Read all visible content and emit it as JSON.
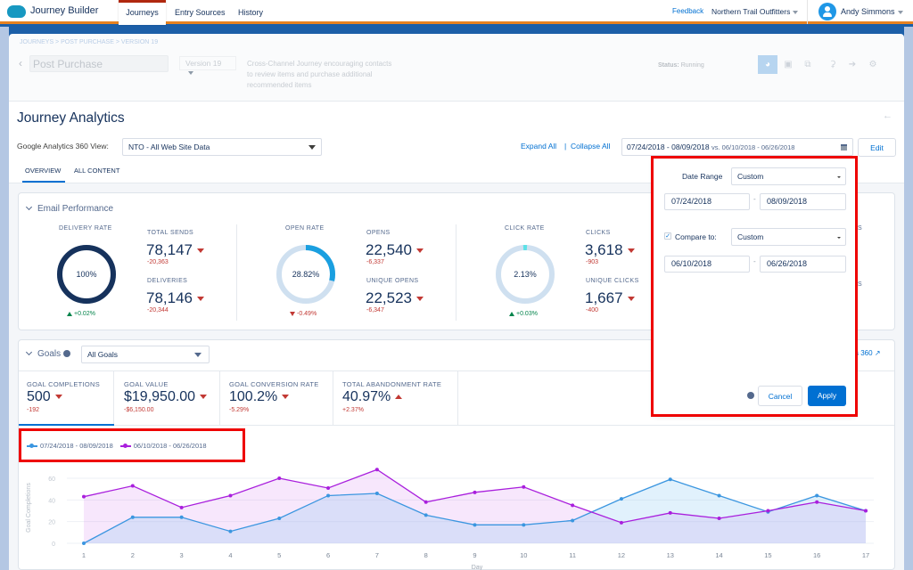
{
  "topnav": {
    "app_name": "Journey Builder",
    "tabs": [
      {
        "label": "Journeys",
        "active": true
      },
      {
        "label": "Entry Sources",
        "active": false
      },
      {
        "label": "History",
        "active": false
      }
    ],
    "feedback": "Feedback",
    "org": "Northern Trail Outfitters",
    "user": "Andy Simmons"
  },
  "journey": {
    "breadcrumb": "JOURNEYS > POST PURCHASE > VERSION 19",
    "name": "Post Purchase",
    "version": "Version 19",
    "description": "Cross-Channel Journey encouraging contacts to review items and purchase additional recommended items",
    "status_label": "Status:",
    "status_value": "Running",
    "toolbar_icons": [
      "analytics-icon",
      "camera-icon",
      "copy-icon",
      "trophy-icon",
      "exit-icon",
      "gear-icon"
    ]
  },
  "analytics": {
    "title": "Journey Analytics",
    "ga_view_label": "Google Analytics 360 View:",
    "ga_view_value": "NTO - All Web Site Data",
    "expand_all": "Expand All",
    "separator": "|",
    "collapse_all": "Collapse All",
    "date_range_primary": "07/24/2018 - 08/09/2018",
    "date_range_vs": "vs. 06/10/2018 - 06/26/2018",
    "edit": "Edit",
    "subtabs": [
      {
        "label": "OVERVIEW",
        "active": true
      },
      {
        "label": "ALL CONTENT",
        "active": false
      }
    ]
  },
  "email_performance": {
    "title": "Email Performance",
    "groups": [
      {
        "donut_label": "DELIVERY RATE",
        "donut_value": "100%",
        "donut_fraction": 1.0,
        "donut_delta": "+0.02%",
        "donut_trend": "up",
        "metrics": [
          {
            "label": "TOTAL SENDS",
            "value": "78,147",
            "delta": "-20,363"
          },
          {
            "label": "DELIVERIES",
            "value": "78,146",
            "delta": "-20,344"
          }
        ]
      },
      {
        "donut_label": "OPEN RATE",
        "donut_value": "28.82%",
        "donut_fraction": 0.2882,
        "donut_delta": "-0.49%",
        "donut_trend": "down",
        "metrics": [
          {
            "label": "OPENS",
            "value": "22,540",
            "delta": "-6,337"
          },
          {
            "label": "UNIQUE OPENS",
            "value": "22,523",
            "delta": "-6,347"
          }
        ]
      },
      {
        "donut_label": "CLICK RATE",
        "donut_value": "2.13%",
        "donut_fraction": 0.0213,
        "donut_delta": "+0.03%",
        "donut_trend": "up",
        "metrics": [
          {
            "label": "CLICKS",
            "value": "3,618",
            "delta": "-903"
          },
          {
            "label": "UNIQUE CLICKS",
            "value": "1,667",
            "delta": "-400"
          }
        ]
      }
    ],
    "truncated_right_letters": [
      "S",
      "S"
    ]
  },
  "goals": {
    "title": "Goals",
    "filter": "All Goals",
    "ga_link_truncated": "cs 360",
    "tiles": [
      {
        "label": "GOAL COMPLETIONS",
        "value": "500",
        "delta": "-192",
        "trend": "down",
        "active": true
      },
      {
        "label": "GOAL VALUE",
        "value": "$19,950.00",
        "delta": "-$6,150.00",
        "trend": "down",
        "active": false
      },
      {
        "label": "GOAL CONVERSION RATE",
        "value": "100.2%",
        "delta": "-5.29%",
        "trend": "down",
        "active": false
      },
      {
        "label": "TOTAL ABANDONMENT RATE",
        "value": "40.97%",
        "delta": "+2.37%",
        "trend": "up",
        "active": false
      }
    ]
  },
  "date_popup": {
    "date_range_label": "Date Range",
    "date_range_value": "Custom",
    "start_date": "07/24/2018",
    "end_date": "08/09/2018",
    "dash": "-",
    "compare_checked": true,
    "compare_label": "Compare to:",
    "compare_value": "Custom",
    "compare_start": "06/10/2018",
    "compare_end": "06/26/2018",
    "cancel": "Cancel",
    "apply": "Apply"
  },
  "colors": {
    "accent": "#0070d2",
    "highlight": "#ee0000",
    "series_current": "#3b96e0",
    "series_compare": "#a91fdd",
    "negative": "#c23934",
    "positive": "#04844b"
  },
  "chart_data": {
    "type": "area",
    "title": "",
    "xlabel": "Day",
    "ylabel": "Goal Completions",
    "x": [
      1,
      2,
      3,
      4,
      5,
      6,
      7,
      8,
      9,
      10,
      11,
      12,
      13,
      14,
      15,
      16,
      17
    ],
    "ylim": [
      0,
      80
    ],
    "yticks": [
      0,
      20,
      40,
      60
    ],
    "grid": true,
    "legend_position": "top-left",
    "series": [
      {
        "name": "07/24/2018 - 08/09/2018",
        "color": "#3b96e0",
        "values": [
          0,
          24,
          24,
          11,
          23,
          44,
          46,
          26,
          17,
          17,
          21,
          41,
          59,
          44,
          29,
          44,
          30
        ]
      },
      {
        "name": "06/10/2018 - 06/26/2018",
        "color": "#a91fdd",
        "values": [
          43,
          53,
          33,
          44,
          60,
          51,
          68,
          38,
          47,
          52,
          35,
          19,
          28,
          23,
          30,
          38,
          30
        ]
      }
    ]
  }
}
